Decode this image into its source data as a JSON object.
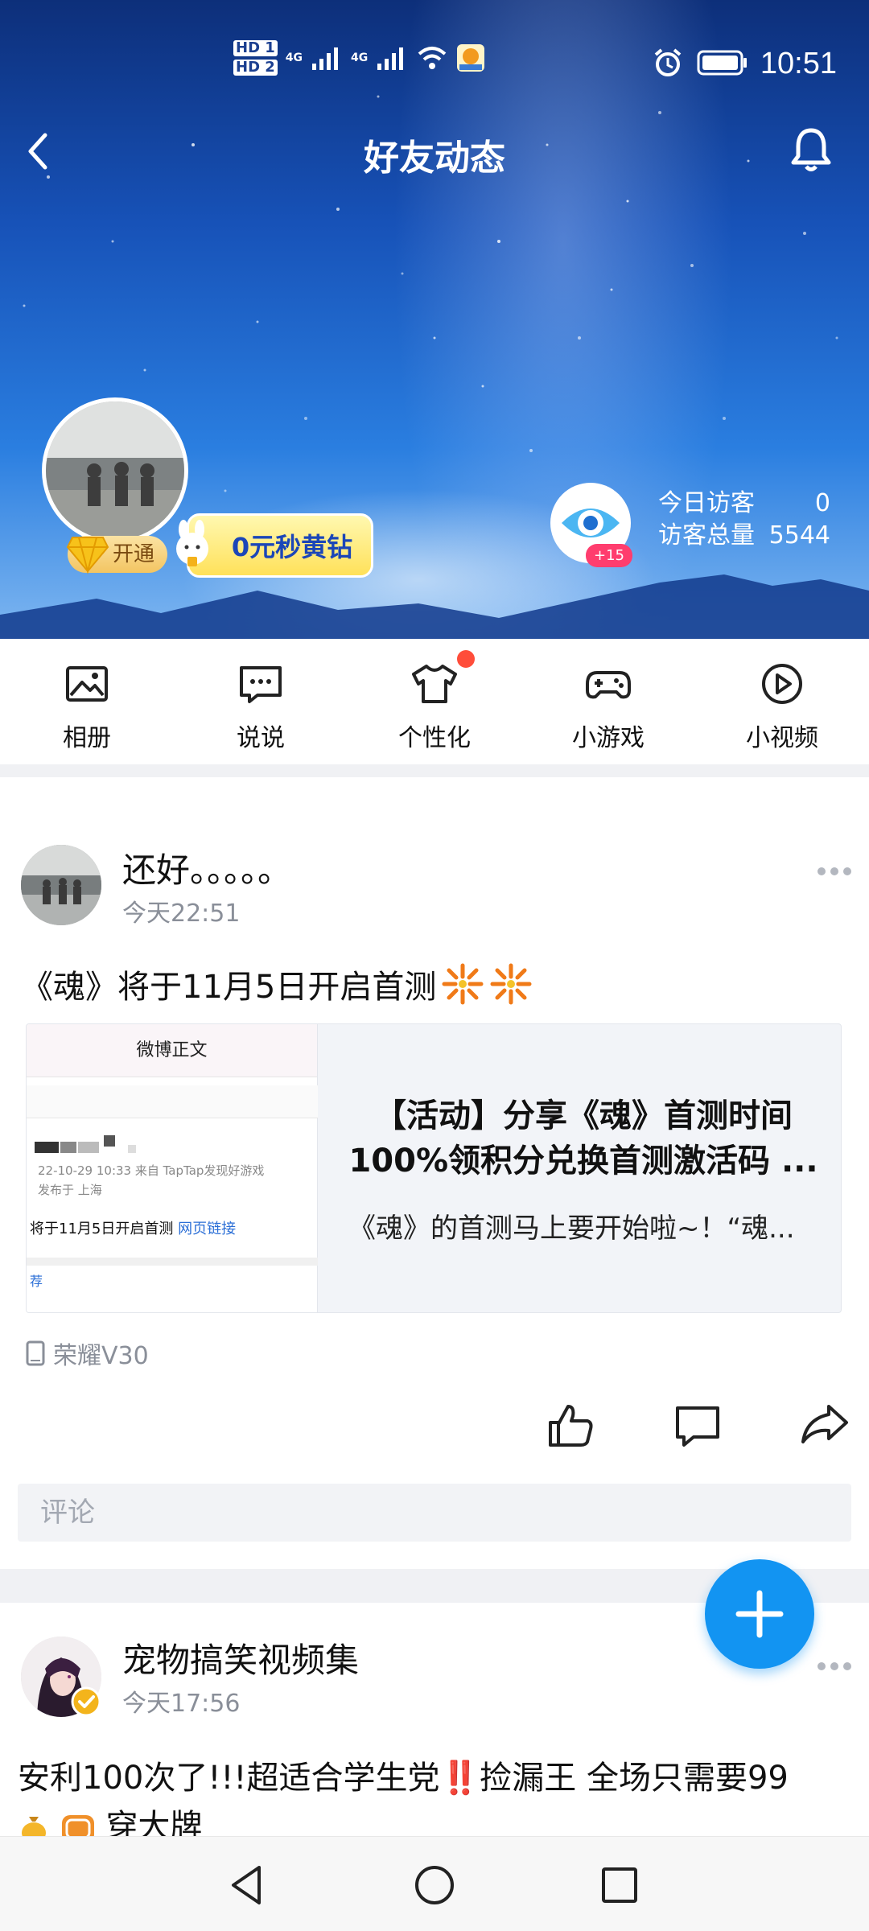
{
  "status_bar": {
    "sim1": "HD 1",
    "sim2": "HD 2",
    "network1": "4G",
    "network2": "4G",
    "time": "10:51"
  },
  "header": {
    "title": "好友动态",
    "back_icon": "chevron-left-icon",
    "bell_icon": "bell-icon"
  },
  "profile": {
    "open_badge": "开通",
    "promo_label": "0元秒黄钻",
    "eye_plus": "+15",
    "today_visitors_label": "今日访客",
    "today_visitors_value": "0",
    "total_visitors_label": "访客总量",
    "total_visitors_value": "5544"
  },
  "shortcuts": [
    {
      "label": "相册",
      "icon": "image-icon"
    },
    {
      "label": "说说",
      "icon": "chat-bubble-icon"
    },
    {
      "label": "个性化",
      "icon": "tshirt-icon"
    },
    {
      "label": "小游戏",
      "icon": "gamepad-icon"
    },
    {
      "label": "小视频",
      "icon": "play-circle-icon"
    }
  ],
  "post1": {
    "author": "还好。。。。。",
    "time": "今天22:51",
    "text": "《魂》将于11月5日开启首测",
    "card": {
      "thumb_header": "微博正文",
      "thumb_meta_line1": "22-10-29 10:33  来自 TapTap发现好游戏",
      "thumb_meta_line2": "发布于 上海",
      "thumb_body": "将于11月5日开启首测",
      "thumb_link": "网页链接",
      "thumb_rec": "荐",
      "title_line1": "【活动】分享《魂》首测时间",
      "title_line2": "100%领积分兑换首测激活码 ...",
      "subtitle": "《魂》的首测马上要开始啦~！“魂..."
    },
    "device": "荣耀V30",
    "comment_placeholder": "评论"
  },
  "post2": {
    "author": "宠物搞笑视频集",
    "time": "今天17:56",
    "text_part1": "安利100次了!!!超适合学生党",
    "text_bang": "‼️",
    "text_part2": "捡漏王 全场只需要99",
    "text_line2": "穿大牌"
  }
}
